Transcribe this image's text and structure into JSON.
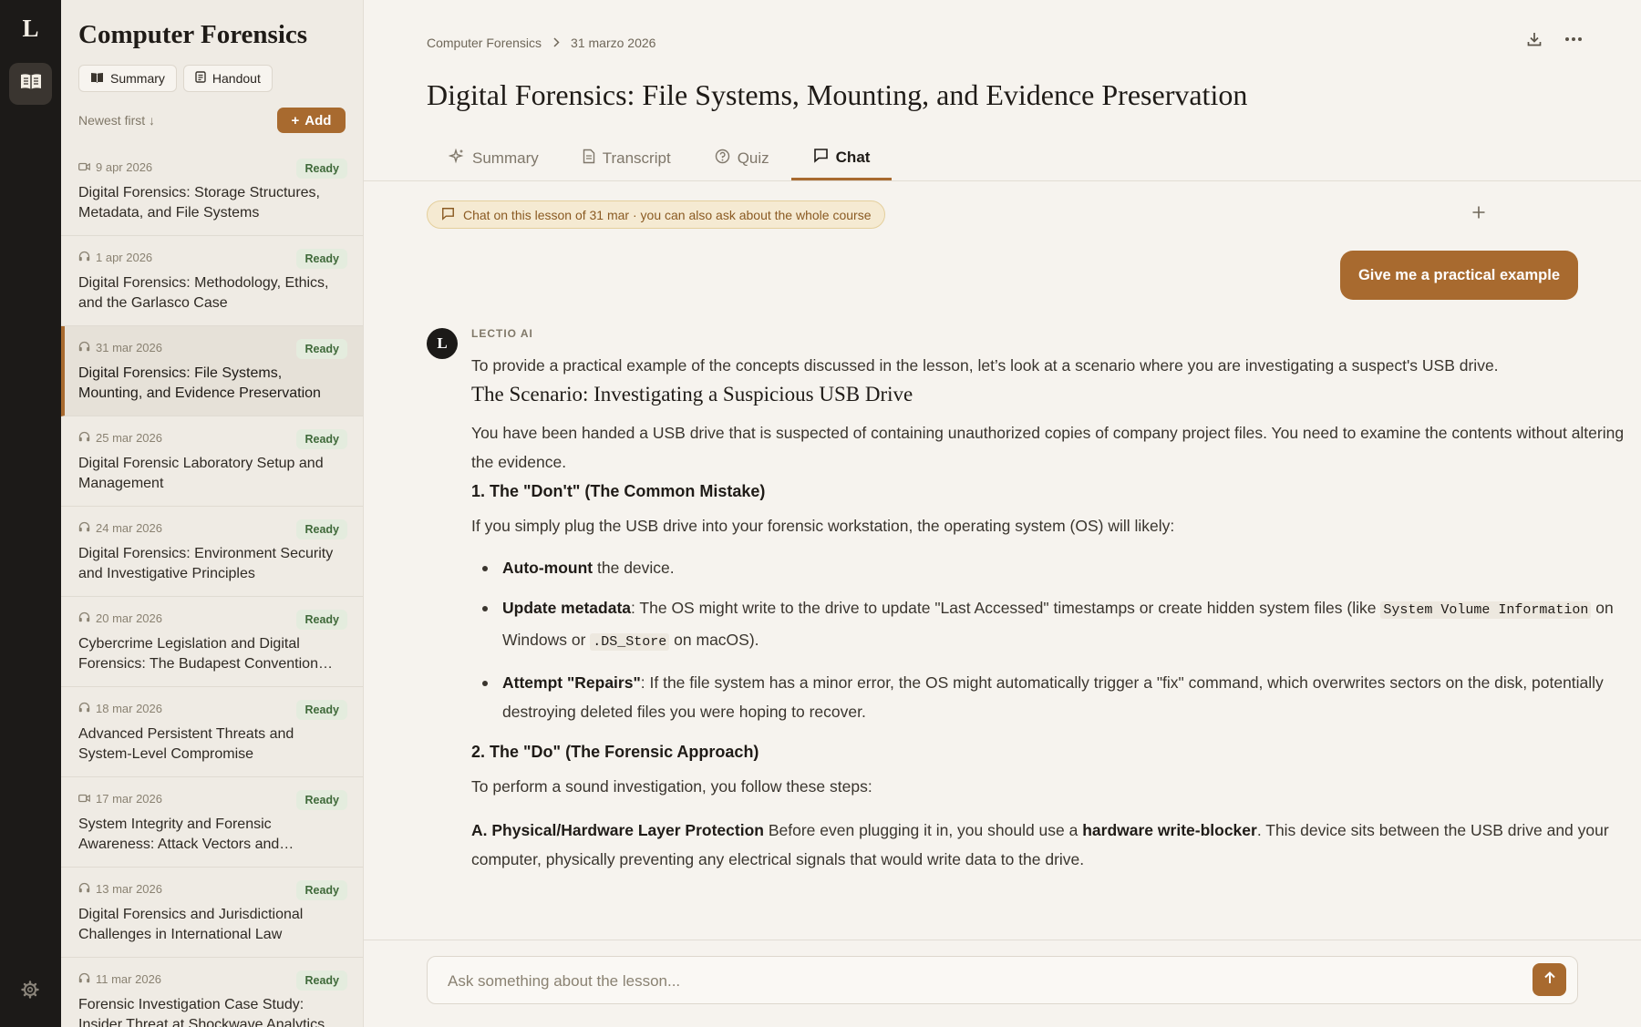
{
  "rail": {
    "logo": "L",
    "icons": [
      "book-open-icon",
      "gear-icon"
    ]
  },
  "sidebar": {
    "title": "Computer Forensics",
    "summary_label": "Summary",
    "handout_label": "Handout",
    "sort_label": "Newest first ↓",
    "add_label": "Add",
    "lessons": [
      {
        "date": "9 apr 2026",
        "icon": "video-icon",
        "status": "Ready",
        "title": "Digital Forensics: Storage Structures, Metadata, and File Systems"
      },
      {
        "date": "1 apr 2026",
        "icon": "headphones-icon",
        "status": "Ready",
        "title": "Digital Forensics: Methodology, Ethics, and the Garlasco Case"
      },
      {
        "date": "31 mar 2026",
        "icon": "headphones-icon",
        "status": "Ready",
        "title": "Digital Forensics: File Systems, Mounting, and Evidence Preservation"
      },
      {
        "date": "25 mar 2026",
        "icon": "headphones-icon",
        "status": "Ready",
        "title": "Digital Forensic Laboratory Setup and Management"
      },
      {
        "date": "24 mar 2026",
        "icon": "headphones-icon",
        "status": "Ready",
        "title": "Digital Forensics: Environment Security and Investigative Principles"
      },
      {
        "date": "20 mar 2026",
        "icon": "headphones-icon",
        "status": "Ready",
        "title": "Cybercrime Legislation and Digital Forensics: The Budapest Convention a..."
      },
      {
        "date": "18 mar 2026",
        "icon": "headphones-icon",
        "status": "Ready",
        "title": "Advanced Persistent Threats and System-Level Compromise"
      },
      {
        "date": "17 mar 2026",
        "icon": "video-icon",
        "status": "Ready",
        "title": "System Integrity and Forensic Awareness: Attack Vectors and Compr..."
      },
      {
        "date": "13 mar 2026",
        "icon": "headphones-icon",
        "status": "Ready",
        "title": "Digital Forensics and Jurisdictional Challenges in International Law"
      },
      {
        "date": "11 mar 2026",
        "icon": "headphones-icon",
        "status": "Ready",
        "title": "Forensic Investigation Case Study: Insider Threat at Shockwave Analytics"
      }
    ]
  },
  "main": {
    "breadcrumb": {
      "course": "Computer Forensics",
      "date": "31 marzo 2026"
    },
    "title": "Digital Forensics: File Systems, Mounting, and Evidence Preservation",
    "tabs": [
      {
        "label": "Summary",
        "icon": "sparkle-icon"
      },
      {
        "label": "Transcript",
        "icon": "document-icon"
      },
      {
        "label": "Quiz",
        "icon": "help-circle-icon"
      },
      {
        "label": "Chat",
        "icon": "chat-icon",
        "active": true
      }
    ],
    "context_pill": "Chat on this lesson of 31 mar · you can also ask about the whole course",
    "user_message": "Give me a practical example",
    "ai": {
      "avatar": "L",
      "label": "LECTIO AI",
      "intro": "To provide a practical example of the concepts discussed in the lesson, let’s look at a scenario where you are investigating a suspect's USB drive.",
      "heading": "The Scenario: Investigating a Suspicious USB Drive",
      "scenario": "You have been handed a USB drive that is suspected of containing unauthorized copies of company project files. You need to examine the contents without altering the evidence.",
      "dont_heading": "1. The \"Don't\" (The Common Mistake)",
      "dont_intro": "If you simply plug the USB drive into your forensic workstation, the operating system (OS) will likely:",
      "bullet1_bold": "Auto-mount",
      "bullet1_text": " the device.",
      "bullet2_bold": "Update metadata",
      "bullet2_text_a": ": The OS might write to the drive to update \"Last Accessed\" timestamps or create hidden system files (like ",
      "bullet2_code1": "System Volume Information",
      "bullet2_text_b": " on Windows or ",
      "bullet2_code2": ".DS_Store",
      "bullet2_text_c": " on macOS).",
      "bullet3_bold": "Attempt \"Repairs\"",
      "bullet3_text": ": If the file system has a minor error, the OS might automatically trigger a \"fix\" command, which overwrites sectors on the disk, potentially destroying deleted files you were hoping to recover.",
      "do_heading": "2. The \"Do\" (The Forensic Approach)",
      "do_intro": "To perform a sound investigation, you follow these steps:",
      "stepA_bold": "A. Physical/Hardware Layer Protection",
      "stepA_text_a": " Before even plugging it in, you should use a ",
      "stepA_bold2": "hardware write-blocker",
      "stepA_text_b": ". This device sits between the USB drive and your computer, physically preventing any electrical signals that would write data to the drive."
    },
    "input_placeholder": "Ask something about the lesson...",
    "colors": {
      "accent": "#a86a2f",
      "ready_bg": "#e4ecde",
      "ready_text": "#3f6a3a"
    }
  }
}
